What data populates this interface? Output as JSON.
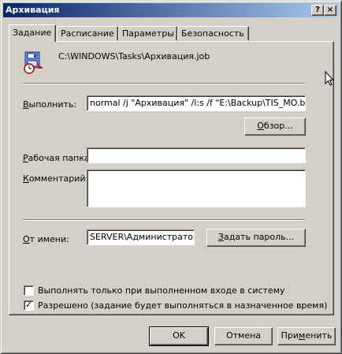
{
  "window": {
    "title": "Архивация",
    "help_button": "?",
    "close_button": "×"
  },
  "tabs": [
    {
      "label": "Задание",
      "active": true
    },
    {
      "label": "Расписание",
      "active": false
    },
    {
      "label": "Параметры",
      "active": false
    },
    {
      "label": "Безопасность",
      "active": false
    }
  ],
  "task": {
    "path": "C:\\WINDOWS\\Tasks\\Архивация.job",
    "icon": "scheduled-task-icon"
  },
  "run": {
    "label_hotkey": "В",
    "label_rest": "ыполнить:",
    "value": "normal /j \"Архивация\" /l:s /f \"E:\\Backup\\TIS_MO.bkf\"",
    "browse_hotkey": "О",
    "browse_rest": "бзор..."
  },
  "workdir": {
    "label_hotkey": "Р",
    "label_rest": "абочая папка:",
    "value": ""
  },
  "comment": {
    "label_hotkey": "К",
    "label_rest": "омментарий:",
    "value": ""
  },
  "runas": {
    "label_hotkey": "О",
    "label_rest": "т имени:",
    "value": "SERVER\\Администратор",
    "password_hotkey": "З",
    "password_rest": "адать пароль..."
  },
  "options": {
    "logged_on_label": "Выполнять только при выполненном входе в систему",
    "logged_on_checked": false,
    "enabled_label": "Разрешено (задание будет выполняться в назначенное время)",
    "enabled_checked": true
  },
  "buttons": {
    "ok": "OK",
    "cancel": "Отмена",
    "apply_start": "При",
    "apply_hotkey": "м",
    "apply_rest": "енить"
  },
  "colors": {
    "titlebar_start": "#0a246a",
    "titlebar_end": "#a6caf0",
    "face": "#d4d0c8"
  }
}
